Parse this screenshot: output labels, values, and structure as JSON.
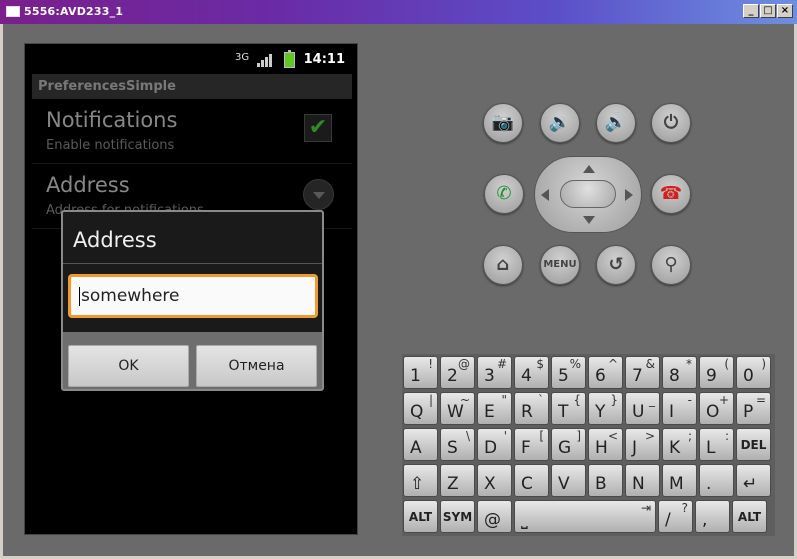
{
  "window": {
    "title": "5556:AVD233_1",
    "minimize": "_",
    "maximize": "□",
    "close": "×"
  },
  "statusbar": {
    "data_type": "3G",
    "time": "14:11"
  },
  "app": {
    "title": "PreferencesSimple"
  },
  "prefs": [
    {
      "title": "Notifications",
      "summary": "Enable notifications"
    },
    {
      "title": "Address",
      "summary": "Address for notifications"
    }
  ],
  "dialog": {
    "title": "Address",
    "value": "somewhere",
    "ok_label": "OK",
    "cancel_label": "Отмена"
  },
  "hw": {
    "menu_label": "MENU"
  },
  "keyboard": {
    "rows": [
      [
        {
          "m": "1",
          "s": "!"
        },
        {
          "m": "2",
          "s": "@"
        },
        {
          "m": "3",
          "s": "#"
        },
        {
          "m": "4",
          "s": "$"
        },
        {
          "m": "5",
          "s": "%"
        },
        {
          "m": "6",
          "s": "^"
        },
        {
          "m": "7",
          "s": "&"
        },
        {
          "m": "8",
          "s": "*"
        },
        {
          "m": "9",
          "s": "("
        },
        {
          "m": "0",
          "s": ")"
        }
      ],
      [
        {
          "m": "Q",
          "s": "|"
        },
        {
          "m": "W",
          "s": "~"
        },
        {
          "m": "E",
          "s": "\""
        },
        {
          "m": "R",
          "s": "`"
        },
        {
          "m": "T",
          "s": "{"
        },
        {
          "m": "Y",
          "s": "}"
        },
        {
          "m": "U",
          "s": "_"
        },
        {
          "m": "I",
          "s": "-"
        },
        {
          "m": "O",
          "s": "+"
        },
        {
          "m": "P",
          "s": "="
        }
      ],
      [
        {
          "m": "A",
          "s": ""
        },
        {
          "m": "S",
          "s": "\\"
        },
        {
          "m": "D",
          "s": "'"
        },
        {
          "m": "F",
          "s": "["
        },
        {
          "m": "G",
          "s": "]"
        },
        {
          "m": "H",
          "s": "<"
        },
        {
          "m": "J",
          "s": ">"
        },
        {
          "m": "K",
          "s": ";"
        },
        {
          "m": "L",
          "s": ":"
        },
        {
          "m": "DEL",
          "s": ""
        }
      ],
      [
        {
          "m": "⇧",
          "s": ""
        },
        {
          "m": "Z",
          "s": ""
        },
        {
          "m": "X",
          "s": ""
        },
        {
          "m": "C",
          "s": ""
        },
        {
          "m": "V",
          "s": ""
        },
        {
          "m": "B",
          "s": ""
        },
        {
          "m": "N",
          "s": ""
        },
        {
          "m": "M",
          "s": ""
        },
        {
          "m": ".",
          "s": ""
        },
        {
          "m": "↵",
          "s": ""
        }
      ],
      [
        {
          "m": "ALT",
          "s": ""
        },
        {
          "m": "SYM",
          "s": ""
        },
        {
          "m": "@",
          "s": ""
        },
        {
          "m": "⎵",
          "s": "⇥"
        },
        {
          "m": "/",
          "s": "?"
        },
        {
          "m": ",",
          "s": ""
        },
        {
          "m": "ALT",
          "s": ""
        }
      ]
    ]
  }
}
